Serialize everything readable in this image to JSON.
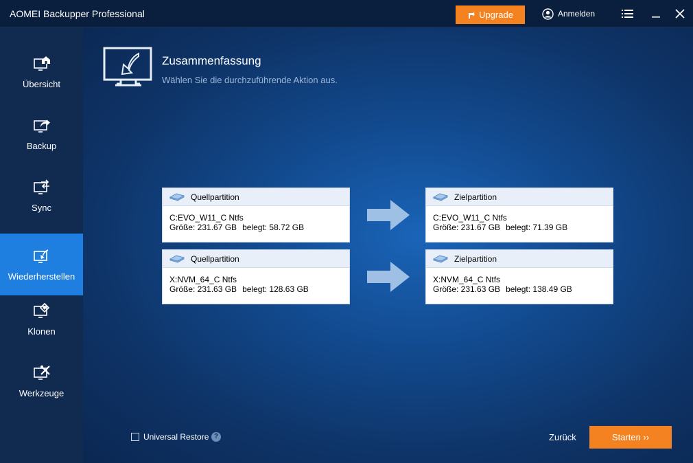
{
  "app": {
    "title": "AOMEI Backupper Professional"
  },
  "titlebar": {
    "upgrade_label": "Upgrade",
    "login_label": "Anmelden",
    "accent_color": "#f58220"
  },
  "sidebar": {
    "items": [
      {
        "label": "Übersicht",
        "icon": "home-monitor-icon",
        "active": false
      },
      {
        "label": "Backup",
        "icon": "backup-monitor-icon",
        "active": false
      },
      {
        "label": "Sync",
        "icon": "sync-monitor-icon",
        "active": false
      },
      {
        "label": "Wiederherstellen",
        "icon": "restore-monitor-icon",
        "active": true
      },
      {
        "label": "Klonen",
        "icon": "clone-monitor-icon",
        "active": false
      },
      {
        "label": "Werkzeuge",
        "icon": "tools-monitor-icon",
        "active": false
      }
    ],
    "active_color": "#1e7fe0"
  },
  "main": {
    "title": "Zusammenfassung",
    "subtitle": "Wählen Sie die durchzuführende Aktion aus.",
    "pairs": [
      {
        "source": {
          "header": "Quellpartition",
          "name": "C:EVO_W11_C Ntfs",
          "size": "Größe: 231.67 GB",
          "used": "belegt: 58.72 GB"
        },
        "target": {
          "header": "Zielpartition",
          "name": "C:EVO_W11_C Ntfs",
          "size": "Größe: 231.67 GB",
          "used": "belegt: 71.39 GB"
        }
      },
      {
        "source": {
          "header": "Quellpartition",
          "name": "X:NVM_64_C Ntfs",
          "size": "Größe: 231.63 GB",
          "used": "belegt: 128.63 GB"
        },
        "target": {
          "header": "Zielpartition",
          "name": "X:NVM_64_C Ntfs",
          "size": "Größe: 231.63 GB",
          "used": "belegt: 138.49 GB"
        }
      }
    ]
  },
  "footer": {
    "universal_restore_label": "Universal Restore",
    "universal_restore_checked": false,
    "help_symbol": "?",
    "back_label": "Zurück",
    "start_label": "Starten ››"
  }
}
